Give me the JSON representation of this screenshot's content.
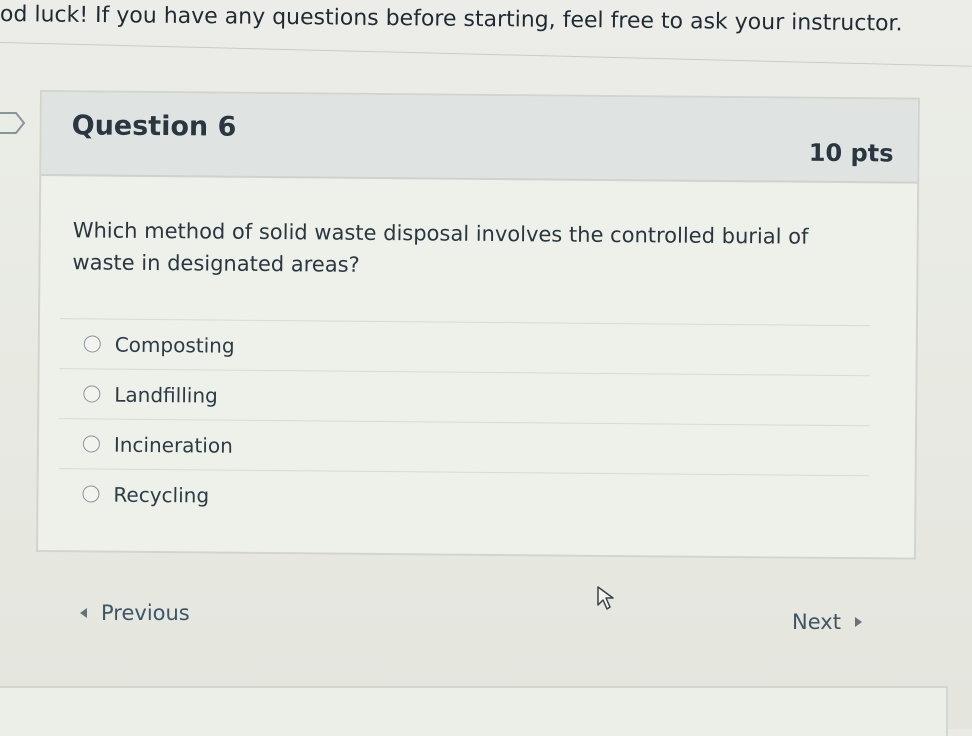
{
  "intro": {
    "text": "od luck! If you have any questions before starting, feel free to ask your instructor."
  },
  "question": {
    "title": "Question 6",
    "points": "10 pts",
    "text": "Which method of solid waste disposal involves the controlled burial of waste in designated areas?",
    "answers": [
      {
        "label": "Composting"
      },
      {
        "label": "Landfilling"
      },
      {
        "label": "Incineration"
      },
      {
        "label": "Recycling"
      }
    ]
  },
  "nav": {
    "previous_label": "Previous",
    "next_label": "Next"
  },
  "icons": {
    "marker": "question-marker-icon",
    "cursor": "mouse-pointer-icon",
    "prev": "triangle-left-icon",
    "next": "triangle-right-icon"
  },
  "colors": {
    "header_bg": "#dfe3e2",
    "text": "#2a3640",
    "link": "#3f5566"
  }
}
